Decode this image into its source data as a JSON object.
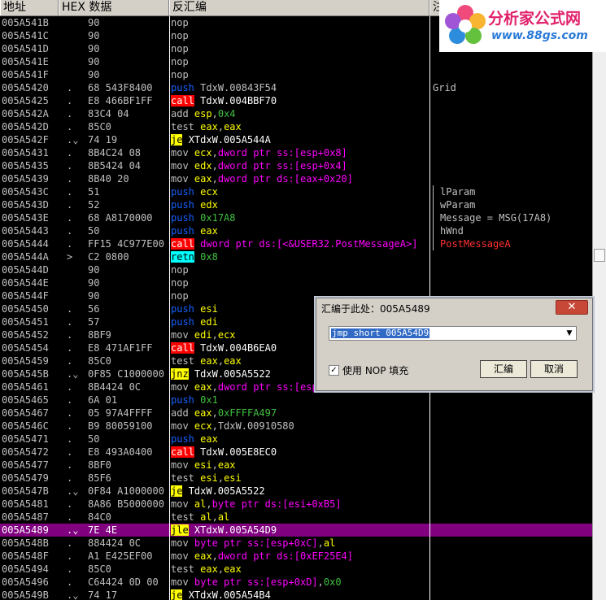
{
  "header": {
    "col_addr": "地址",
    "col_hex": "HEX 数据",
    "col_asm": "反汇编",
    "col_cmt": "注"
  },
  "colors": {
    "mnem": "#9c9c9c",
    "push": "#1560ff",
    "call_bg": "#ff0000",
    "call_fg": "#ffffff",
    "jmp_bg": "#ffff00",
    "jmp_fg": "#000000",
    "reg": "#ffff00",
    "mem": "#ff00ff",
    "imm": "#40c040",
    "opt": "#c0c0c0",
    "sel_bg": "#800080"
  },
  "rows": [
    {
      "a": "005A541B",
      "m": "",
      "h": "90",
      "k": "nop",
      "t": "nop",
      "o": []
    },
    {
      "a": "005A541C",
      "m": "",
      "h": "90",
      "k": "nop",
      "t": "nop",
      "o": []
    },
    {
      "a": "005A541D",
      "m": "",
      "h": "90",
      "k": "nop",
      "t": "nop",
      "o": []
    },
    {
      "a": "005A541E",
      "m": "",
      "h": "90",
      "k": "nop",
      "t": "nop",
      "o": []
    },
    {
      "a": "005A541F",
      "m": "",
      "h": "90",
      "k": "nop",
      "t": "nop",
      "o": []
    },
    {
      "a": "005A5420",
      "m": ".",
      "h": "68 543F8400",
      "k": "push",
      "t": "push",
      "o": [
        [
          "plain",
          "TdxW.00843F54"
        ]
      ],
      "c": "Grid"
    },
    {
      "a": "005A5425",
      "m": ".",
      "h": "E8 466BF1FF",
      "k": "call",
      "t": "call",
      "o": [
        [
          "plain",
          "TdxW.004BBF70"
        ]
      ]
    },
    {
      "a": "005A542A",
      "m": ".",
      "h": "83C4 04",
      "k": "mov",
      "t": "add",
      "o": [
        [
          "reg",
          "esp"
        ],
        [
          "plain",
          ","
        ],
        [
          "imm",
          "0x4"
        ]
      ]
    },
    {
      "a": "005A542D",
      "m": ".",
      "h": "85C0",
      "k": "mov",
      "t": "test",
      "o": [
        [
          "reg",
          "eax"
        ],
        [
          "plain",
          ","
        ],
        [
          "reg",
          "eax"
        ]
      ]
    },
    {
      "a": "005A542F",
      "m": ".⌄",
      "h": "74 19",
      "k": "jmp",
      "t": "je",
      "o": [
        [
          "plain",
          "XTdxW.005A544A"
        ]
      ]
    },
    {
      "a": "005A5431",
      "m": ".",
      "h": "8B4C24 08",
      "k": "mov",
      "t": "mov",
      "o": [
        [
          "reg",
          "ecx"
        ],
        [
          "plain",
          ","
        ],
        [
          "mem",
          "dword ptr ss:[esp+0x8]"
        ]
      ]
    },
    {
      "a": "005A5435",
      "m": ".",
      "h": "8B5424 04",
      "k": "mov",
      "t": "mov",
      "o": [
        [
          "reg",
          "edx"
        ],
        [
          "plain",
          ","
        ],
        [
          "mem",
          "dword ptr ss:[esp+0x4]"
        ]
      ]
    },
    {
      "a": "005A5439",
      "m": ".",
      "h": "8B40 20",
      "k": "mov",
      "t": "mov",
      "o": [
        [
          "reg",
          "eax"
        ],
        [
          "plain",
          ","
        ],
        [
          "mem",
          "dword ptr ds:[eax+0x20]"
        ]
      ]
    },
    {
      "a": "005A543C",
      "m": ".",
      "h": "51",
      "k": "push",
      "t": "push",
      "o": [
        [
          "reg",
          "ecx"
        ]
      ],
      "c": "lParam",
      "br": "top"
    },
    {
      "a": "005A543D",
      "m": ".",
      "h": "52",
      "k": "push",
      "t": "push",
      "o": [
        [
          "reg",
          "edx"
        ]
      ],
      "c": "wParam",
      "br": "mid"
    },
    {
      "a": "005A543E",
      "m": ".",
      "h": "68 A8170000",
      "k": "push",
      "t": "push",
      "o": [
        [
          "imm",
          "0x17A8"
        ]
      ],
      "c": "Message = MSG(17A8)",
      "br": "mid"
    },
    {
      "a": "005A5443",
      "m": ".",
      "h": "50",
      "k": "push",
      "t": "push",
      "o": [
        [
          "reg",
          "eax"
        ]
      ],
      "c": "hWnd",
      "br": "mid"
    },
    {
      "a": "005A5444",
      "m": ".",
      "h": "FF15 4C977E00",
      "k": "call",
      "t": "call",
      "o": [
        [
          "mem",
          "dword ptr ds:[<&USER32.PostMessageA>]"
        ]
      ],
      "c": "PostMessageA",
      "cred": true,
      "br": "bot"
    },
    {
      "a": "005A544A",
      "m": ">",
      "h": "C2 0800",
      "k": "ret",
      "t": "retn",
      "o": [
        [
          "imm",
          "0x8"
        ]
      ]
    },
    {
      "a": "005A544D",
      "m": "",
      "h": "90",
      "k": "nop",
      "t": "nop",
      "o": []
    },
    {
      "a": "005A544E",
      "m": "",
      "h": "90",
      "k": "nop",
      "t": "nop",
      "o": []
    },
    {
      "a": "005A544F",
      "m": "",
      "h": "90",
      "k": "nop",
      "t": "nop",
      "o": []
    },
    {
      "a": "005A5450",
      "m": ".",
      "h": "56",
      "k": "push",
      "t": "push",
      "o": [
        [
          "reg",
          "esi"
        ]
      ]
    },
    {
      "a": "005A5451",
      "m": ".",
      "h": "57",
      "k": "push",
      "t": "push",
      "o": [
        [
          "reg",
          "edi"
        ]
      ]
    },
    {
      "a": "005A5452",
      "m": ".",
      "h": "8BF9",
      "k": "mov",
      "t": "mov",
      "o": [
        [
          "reg",
          "edi"
        ],
        [
          "plain",
          ","
        ],
        [
          "reg",
          "ecx"
        ]
      ]
    },
    {
      "a": "005A5454",
      "m": ".",
      "h": "E8 471AF1FF",
      "k": "call",
      "t": "call",
      "o": [
        [
          "plain",
          "TdxW.004B6EA0"
        ]
      ]
    },
    {
      "a": "005A5459",
      "m": ".",
      "h": "85C0",
      "k": "mov",
      "t": "test",
      "o": [
        [
          "reg",
          "eax"
        ],
        [
          "plain",
          ","
        ],
        [
          "reg",
          "eax"
        ]
      ]
    },
    {
      "a": "005A545B",
      "m": ".⌄",
      "h": "0F85 C1000000",
      "k": "jmp",
      "t": "jnz",
      "o": [
        [
          "plain",
          "TdxW.005A5522"
        ]
      ]
    },
    {
      "a": "005A5461",
      "m": ".",
      "h": "8B4424 0C",
      "k": "mov",
      "t": "mov",
      "o": [
        [
          "reg",
          "eax"
        ],
        [
          "plain",
          ","
        ],
        [
          "mem",
          "dword ptr ss:[esp+0xC]"
        ]
      ]
    },
    {
      "a": "005A5465",
      "m": ".",
      "h": "6A 01",
      "k": "push",
      "t": "push",
      "o": [
        [
          "imm",
          "0x1"
        ]
      ]
    },
    {
      "a": "005A5467",
      "m": ".",
      "h": "05 97A4FFFF",
      "k": "mov",
      "t": "add",
      "o": [
        [
          "reg",
          "eax"
        ],
        [
          "plain",
          ","
        ],
        [
          "imm",
          "0xFFFFA497"
        ]
      ]
    },
    {
      "a": "005A546C",
      "m": ".",
      "h": "B9 80059100",
      "k": "mov",
      "t": "mov",
      "o": [
        [
          "reg",
          "ecx"
        ],
        [
          "plain",
          ",TdxW.00910580"
        ]
      ]
    },
    {
      "a": "005A5471",
      "m": ".",
      "h": "50",
      "k": "push",
      "t": "push",
      "o": [
        [
          "reg",
          "eax"
        ]
      ]
    },
    {
      "a": "005A5472",
      "m": ".",
      "h": "E8 493A0400",
      "k": "call",
      "t": "call",
      "o": [
        [
          "plain",
          "TdxW.005E8EC0"
        ]
      ]
    },
    {
      "a": "005A5477",
      "m": ".",
      "h": "8BF0",
      "k": "mov",
      "t": "mov",
      "o": [
        [
          "reg",
          "esi"
        ],
        [
          "plain",
          ","
        ],
        [
          "reg",
          "eax"
        ]
      ]
    },
    {
      "a": "005A5479",
      "m": ".",
      "h": "85F6",
      "k": "mov",
      "t": "test",
      "o": [
        [
          "reg",
          "esi"
        ],
        [
          "plain",
          ","
        ],
        [
          "reg",
          "esi"
        ]
      ]
    },
    {
      "a": "005A547B",
      "m": ".⌄",
      "h": "0F84 A1000000",
      "k": "jmp",
      "t": "je",
      "o": [
        [
          "plain",
          "TdxW.005A5522"
        ]
      ]
    },
    {
      "a": "005A5481",
      "m": ".",
      "h": "8A86 B5000000",
      "k": "mov",
      "t": "mov",
      "o": [
        [
          "reg",
          "al"
        ],
        [
          "plain",
          ","
        ],
        [
          "mem",
          "byte ptr ds:[esi+0xB5]"
        ]
      ]
    },
    {
      "a": "005A5487",
      "m": ".",
      "h": "84C0",
      "k": "mov",
      "t": "test",
      "o": [
        [
          "reg",
          "al"
        ],
        [
          "plain",
          ","
        ],
        [
          "reg",
          "al"
        ]
      ]
    },
    {
      "a": "005A5489",
      "m": ".⌄",
      "h": "7E 4E",
      "k": "jmp",
      "t": "jle",
      "o": [
        [
          "plain",
          "XTdxW.005A54D9"
        ]
      ],
      "sel": true
    },
    {
      "a": "005A548B",
      "m": ".",
      "h": "884424 0C",
      "k": "mov",
      "t": "mov",
      "o": [
        [
          "mem",
          "byte ptr ss:[esp+0xC]"
        ],
        [
          "plain",
          ","
        ],
        [
          "reg",
          "al"
        ]
      ]
    },
    {
      "a": "005A548F",
      "m": ".",
      "h": "A1 E425EF00",
      "k": "mov",
      "t": "mov",
      "o": [
        [
          "reg",
          "eax"
        ],
        [
          "plain",
          ","
        ],
        [
          "mem",
          "dword ptr ds:[0xEF25E4]"
        ]
      ]
    },
    {
      "a": "005A5494",
      "m": ".",
      "h": "85C0",
      "k": "mov",
      "t": "test",
      "o": [
        [
          "reg",
          "eax"
        ],
        [
          "plain",
          ","
        ],
        [
          "reg",
          "eax"
        ]
      ]
    },
    {
      "a": "005A5496",
      "m": ".",
      "h": "C64424 0D 00",
      "k": "mov",
      "t": "mov",
      "o": [
        [
          "mem",
          "byte ptr ss:[esp+0xD]"
        ],
        [
          "plain",
          ","
        ],
        [
          "imm",
          "0x0"
        ]
      ]
    },
    {
      "a": "005A549B",
      "m": ".⌄",
      "h": "74 17",
      "k": "jmp",
      "t": "je",
      "o": [
        [
          "plain",
          "XTdxW.005A54B4"
        ]
      ]
    }
  ],
  "logo": {
    "name": "分析家公式网",
    "url": "www.88gs.com"
  },
  "dialog": {
    "title": "汇编于此处：005A5489",
    "close": "✕",
    "input_value": "jmp short 005A54D9",
    "nop_label": "使用 NOP 填充",
    "nop_checked": "✓",
    "assemble_label": "汇编",
    "cancel_label": "取消"
  }
}
